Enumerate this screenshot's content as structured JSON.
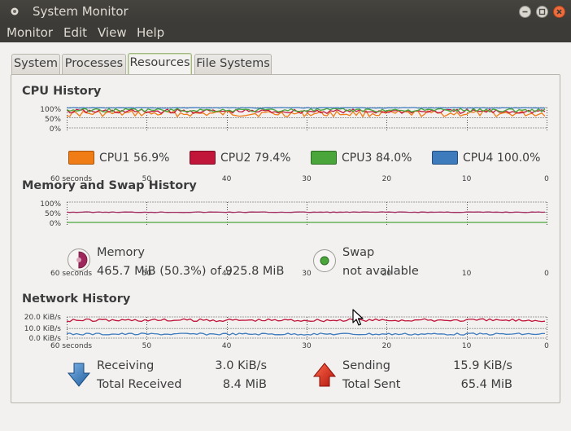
{
  "window": {
    "title": "System Monitor",
    "controls": [
      "minimize-icon",
      "maximize-icon",
      "close-icon"
    ]
  },
  "menubar": {
    "items": [
      "Monitor",
      "Edit",
      "View",
      "Help"
    ]
  },
  "tabs": [
    {
      "label": "System",
      "active": false
    },
    {
      "label": "Processes",
      "active": false
    },
    {
      "label": "Resources",
      "active": true
    },
    {
      "label": "File Systems",
      "active": false
    }
  ],
  "cpu": {
    "title": "CPU History",
    "y_ticks": [
      "100%",
      "50%",
      "0%"
    ],
    "x_ticks": [
      "60 seconds",
      "50",
      "40",
      "30",
      "20",
      "10",
      "0"
    ],
    "cores": [
      {
        "name": "CPU1",
        "value": "56.9%",
        "color": "#f07c16"
      },
      {
        "name": "CPU2",
        "value": "79.4%",
        "color": "#c1163a"
      },
      {
        "name": "CPU3",
        "value": "84.0%",
        "color": "#4aa63b"
      },
      {
        "name": "CPU4",
        "value": "100.0%",
        "color": "#3d7bbd"
      }
    ]
  },
  "memory": {
    "title": "Memory and Swap History",
    "y_ticks": [
      "100%",
      "50%",
      "0%"
    ],
    "x_ticks": [
      "60 seconds",
      "50",
      "40",
      "30",
      "20",
      "10",
      "0"
    ],
    "memory_label": "Memory",
    "memory_value": "465.7 MiB (50.3%) of 925.8 MiB",
    "memory_color": "#a0275c",
    "memory_fraction": 0.503,
    "swap_label": "Swap",
    "swap_value": "not available",
    "swap_color": "#4aa63b"
  },
  "network": {
    "title": "Network History",
    "y_ticks": [
      "20.0 KiB/s",
      "10.0 KiB/s",
      "0.0 KiB/s"
    ],
    "x_ticks": [
      "60 seconds",
      "50",
      "40",
      "30",
      "20",
      "10",
      "0"
    ],
    "receiving_label": "Receiving",
    "receiving_value": "3.0 KiB/s",
    "total_received_label": "Total Received",
    "total_received_value": "8.4 MiB",
    "sending_label": "Sending",
    "sending_value": "15.9 KiB/s",
    "total_sent_label": "Total Sent",
    "total_sent_value": "65.4 MiB",
    "receive_color": "#3d7bbd",
    "send_color": "#c1163a"
  }
}
